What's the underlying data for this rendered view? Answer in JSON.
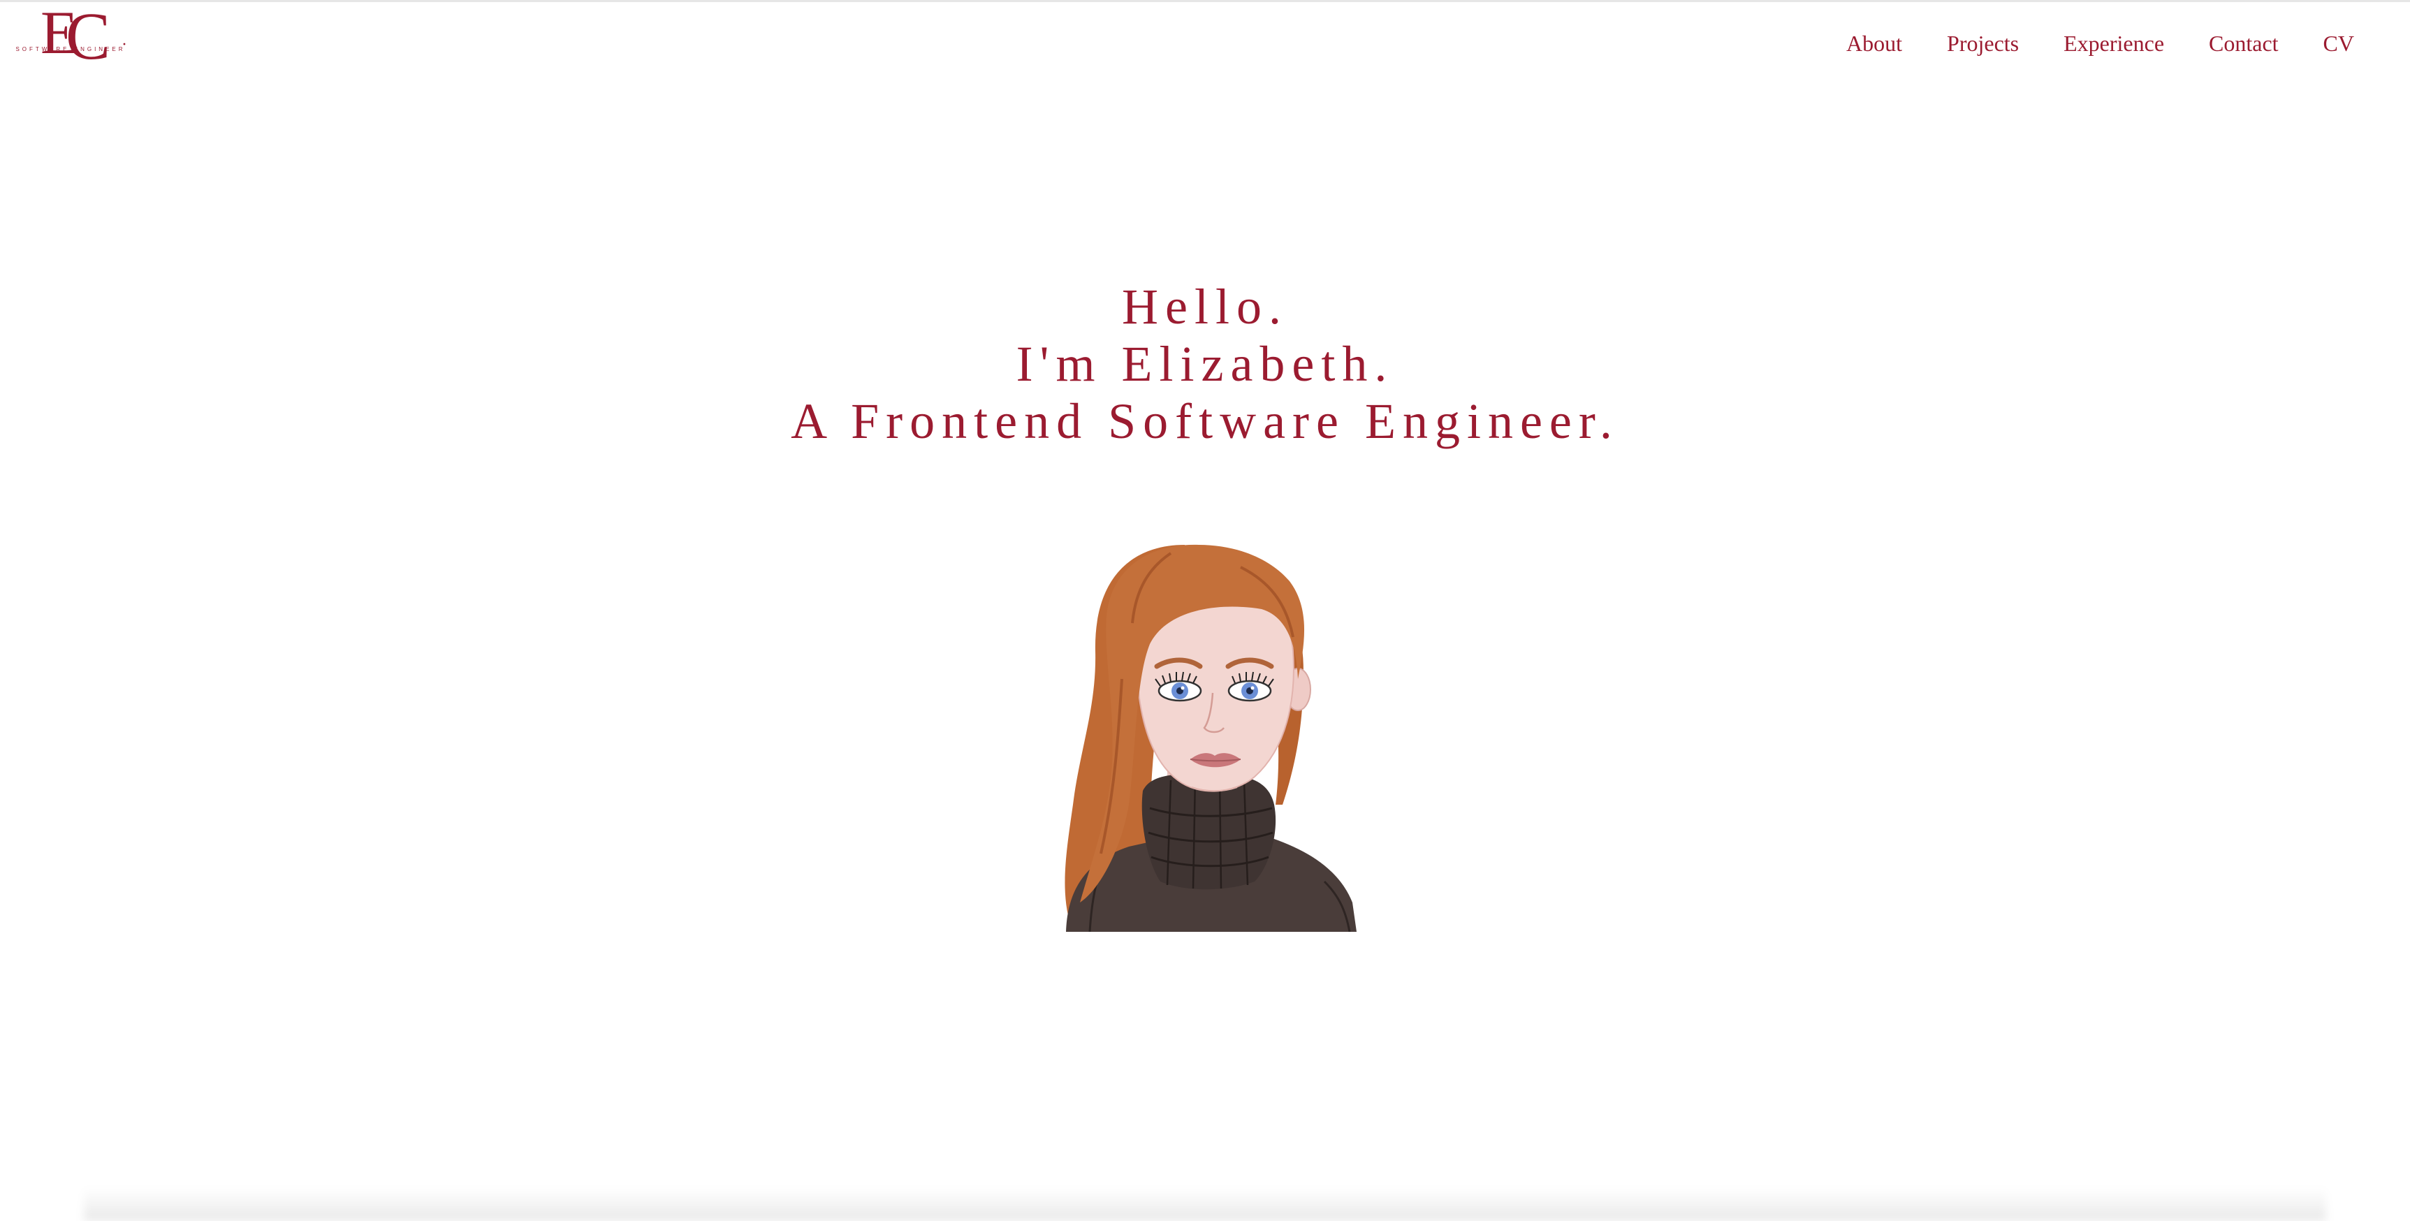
{
  "logo": {
    "mark_e": "E",
    "mark_c": "C",
    "mark_dot": "·",
    "subtitle": "SOFTWARE ENGINEER"
  },
  "nav": {
    "items": [
      {
        "label": "About"
      },
      {
        "label": "Projects"
      },
      {
        "label": "Experience"
      },
      {
        "label": "Contact"
      },
      {
        "label": "CV"
      }
    ]
  },
  "hero": {
    "line1": "Hello.",
    "line2": "I'm Elizabeth.",
    "line3": "A Frontend Software Engineer."
  },
  "avatar": {
    "icon": "woman-avatar-illustration"
  },
  "colors": {
    "accent": "#9b1b30",
    "background": "#ffffff",
    "hair": "#c4703a",
    "skin": "#f2d3cf",
    "sweater": "#4a3d3a"
  }
}
